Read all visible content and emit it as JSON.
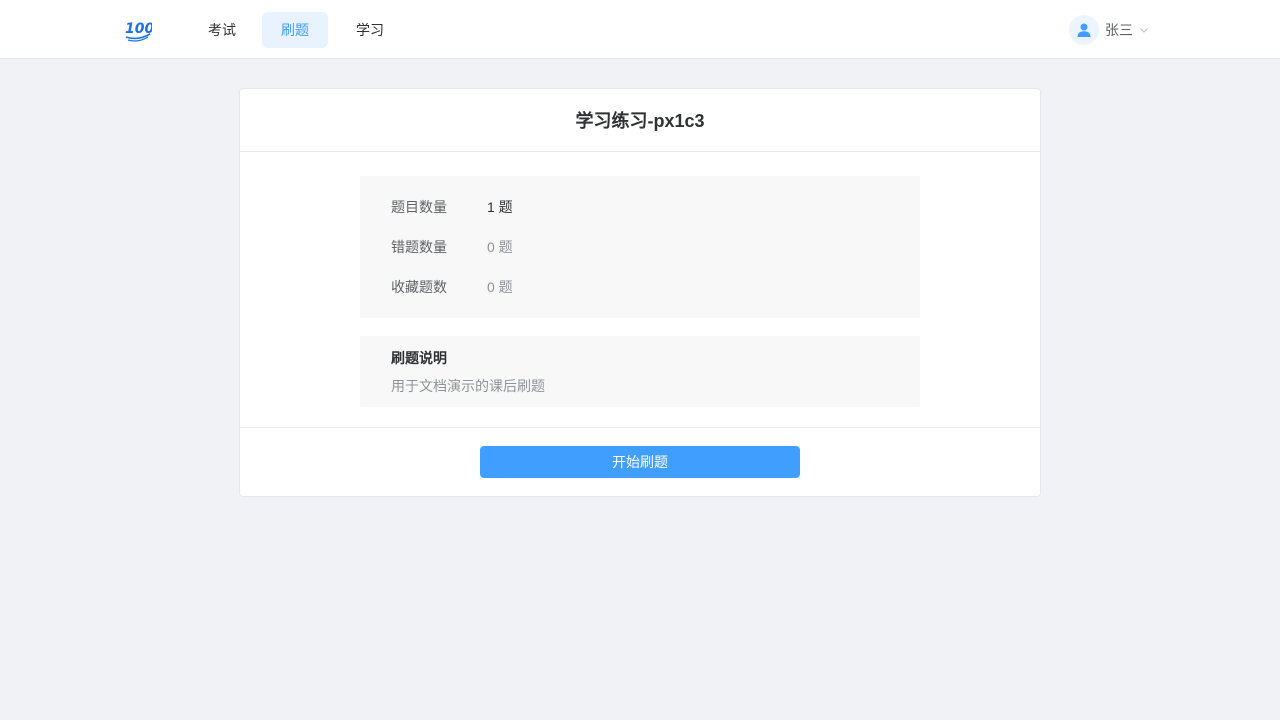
{
  "header": {
    "logo_text": "100",
    "nav": [
      {
        "label": "考试"
      },
      {
        "label": "刷题",
        "active": true
      },
      {
        "label": "学习"
      }
    ],
    "user": {
      "name": "张三"
    }
  },
  "card": {
    "title": "学习练习-px1c3",
    "stats": [
      {
        "label": "题目数量",
        "value": "1 题"
      },
      {
        "label": "错题数量",
        "value": "0 题"
      },
      {
        "label": "收藏题数",
        "value": "0 题"
      }
    ],
    "description": {
      "title": "刷题说明",
      "text": "用于文档演示的课后刷题"
    },
    "start_button": "开始刷题"
  },
  "colors": {
    "accent": "#409eff",
    "active_nav_bg": "#e8f3ff",
    "page_bg": "#f0f2f5"
  },
  "icons": {
    "logo": "hundred-points-logo",
    "avatar": "user-icon",
    "dropdown": "chevron-down-icon"
  }
}
